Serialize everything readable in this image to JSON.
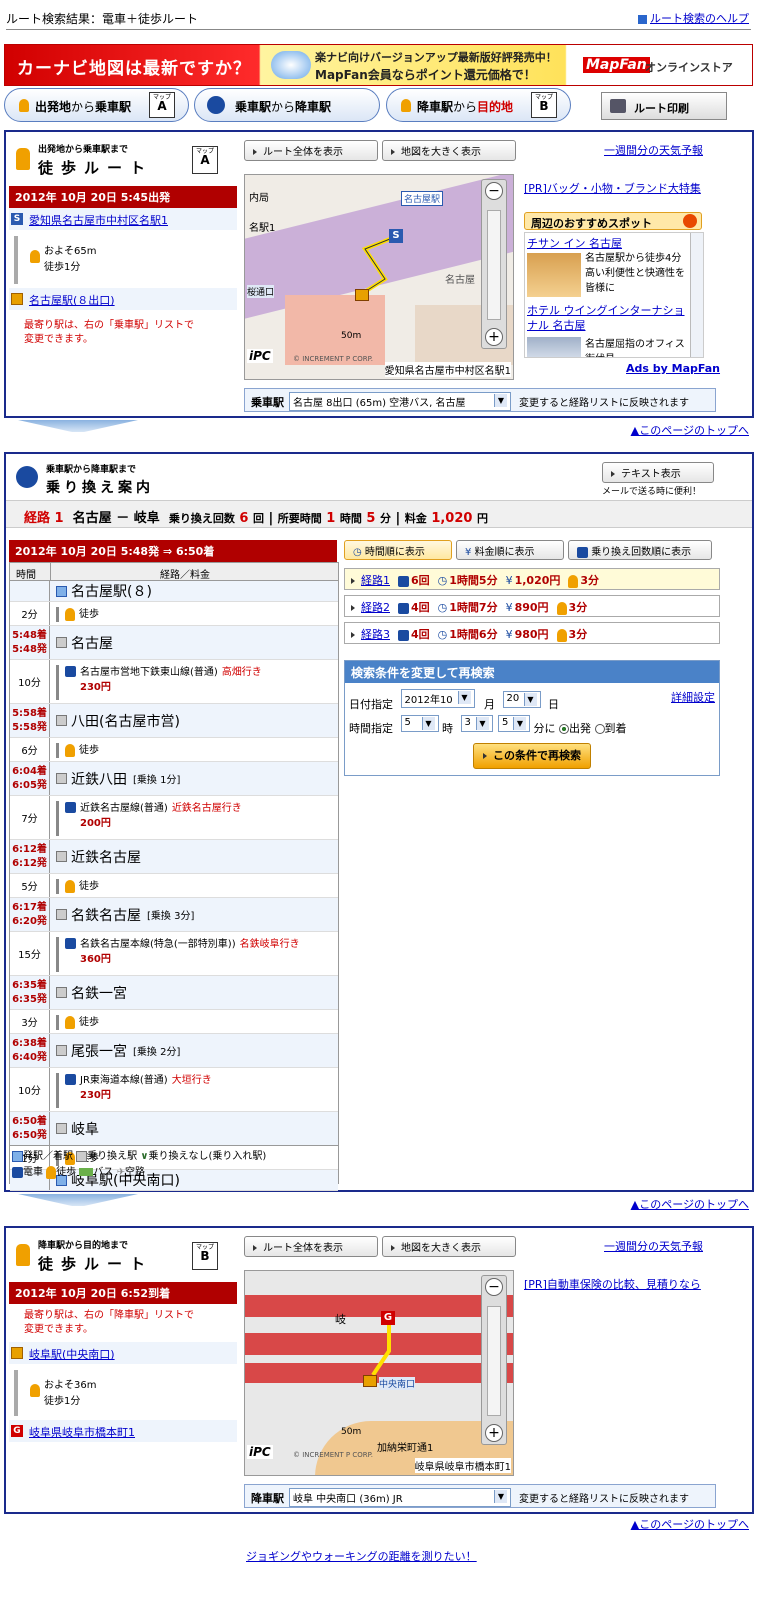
{
  "header": {
    "title": "ルート検索結果：電車＋徒歩ルート",
    "help_link": "ルート検索のヘルプ"
  },
  "banner": {
    "left_text": "カーナビ地図は最新ですか？",
    "middle_line1": "楽ナビ向けバージョンアップ最新版好評発売中！",
    "middle_line2": "MapFan会員ならポイント還元価格で！",
    "brand": "MapFan",
    "brand_sub": "オンラインストア"
  },
  "tabs": [
    {
      "label_pre": "出発地",
      "label_mid": "から",
      "label_post": "乗車駅",
      "map_badge": "A"
    },
    {
      "label_pre": "乗車駅",
      "label_mid": "から",
      "label_post": "降車駅",
      "map_badge": ""
    },
    {
      "label_pre": "降車駅",
      "label_mid": "から",
      "label_post": "目的地",
      "map_badge": "B"
    }
  ],
  "print_button": "ルート印刷",
  "map_badge_label": "マップ",
  "common": {
    "show_route": "ルート全体を表示",
    "enlarge_map": "地図を大きく表示",
    "weather": "一週間分の天気予報",
    "change_note": "変更すると経路リストに反映されます",
    "page_top": "▲このページのトップへ",
    "scale": "50m",
    "copyright": "© INCREMENT P CORP.",
    "ipc": "iPC",
    "walk_label": "徒歩"
  },
  "walk_a": {
    "small_title": "出発地から乗車駅まで",
    "big_title": "徒歩ルート",
    "badge": "A",
    "datetime": "2012年 10月 20日 5:45出発",
    "start_marker": "S",
    "start_place": "愛知県名古屋市中村区名駅1",
    "distance": "およそ65m",
    "time": "徒歩1分",
    "end_place": "名古屋駅(８出口)",
    "note_line1": "最寄り駅は、右の「乗車駅」リストで",
    "note_line2": "変更できます。",
    "map_address": "愛知県名古屋市中村区名駅1",
    "map_label_station": "名古屋駅",
    "map_label_1": "名駅1",
    "map_label_2": "名古屋",
    "map_label_3": "内局",
    "map_label_4": "桜通口",
    "pr": "[PR]バッグ・小物・ブランド大特集",
    "spots_title": "周辺のおすすめスポット",
    "spots": [
      {
        "name": "チサン イン 名古屋",
        "desc": "名古屋駅から徒歩4分 高い利便性と快適性を皆様に"
      },
      {
        "name": "ホテル ウイングインターナショナル 名古屋",
        "desc": "名古屋屈指のオフィス街伏見"
      }
    ],
    "ads": "Ads by MapFan",
    "station_select_label": "乗車駅",
    "station_select_value": "名古屋 8出口 (65m) 空港バス, 名古屋"
  },
  "transfer": {
    "small_title": "乗車駅から降車駅まで",
    "big_title": "乗り換え案内",
    "text_button": "テキスト表示",
    "mail_note": "メールで送る時に便利！",
    "summary_label": "経路",
    "summary_num": "1",
    "summary_from": "名古屋",
    "summary_dash": "－",
    "summary_to": "岐阜",
    "summary_transfers_label": "乗り換え回数",
    "summary_transfers": "6",
    "summary_transfers_unit": "回",
    "summary_time_label": "所要時間",
    "summary_hours": "1",
    "summary_hours_unit": "時間",
    "summary_mins": "5",
    "summary_mins_unit": "分",
    "summary_fare_label": "料金",
    "summary_fare": "1,020",
    "summary_fare_unit": "円",
    "datetime": "2012年 10月 20日 5:48発 ⇒ 6:50着",
    "sort_buttons": [
      "時間順に表示",
      "料金順に表示",
      "乗り換え回数順に表示"
    ],
    "col_time": "時間",
    "col_route": "経路／料金",
    "rows": [
      {
        "type": "station",
        "arr": "",
        "dep": "",
        "name": "名古屋駅(８)",
        "note": "",
        "end": true
      },
      {
        "type": "walk",
        "dur": "2分",
        "line": "徒歩",
        "dest": "",
        "fare": ""
      },
      {
        "type": "station",
        "arr": "5:48着",
        "dep": "5:48発",
        "name": "名古屋",
        "note": ""
      },
      {
        "type": "ride",
        "dur": "10分",
        "line": "名古屋市営地下鉄東山線(普通)",
        "dest": "高畑行き",
        "fare": "230円"
      },
      {
        "type": "station",
        "arr": "5:58着",
        "dep": "5:58発",
        "name": "八田(名古屋市営)",
        "note": ""
      },
      {
        "type": "walk",
        "dur": "6分",
        "line": "徒歩",
        "dest": "",
        "fare": ""
      },
      {
        "type": "station",
        "arr": "6:04着",
        "dep": "6:05発",
        "name": "近鉄八田",
        "note": "[乗換 1分]"
      },
      {
        "type": "ride",
        "dur": "7分",
        "line": "近鉄名古屋線(普通)",
        "dest": "近鉄名古屋行き",
        "fare": "200円"
      },
      {
        "type": "station",
        "arr": "6:12着",
        "dep": "6:12発",
        "name": "近鉄名古屋",
        "note": ""
      },
      {
        "type": "walk",
        "dur": "5分",
        "line": "徒歩",
        "dest": "",
        "fare": ""
      },
      {
        "type": "station",
        "arr": "6:17着",
        "dep": "6:20発",
        "name": "名鉄名古屋",
        "note": "[乗換 3分]"
      },
      {
        "type": "ride",
        "dur": "15分",
        "line": "名鉄名古屋本線(特急(一部特別車))",
        "dest": "名鉄岐阜行き",
        "fare": "360円"
      },
      {
        "type": "station",
        "arr": "6:35着",
        "dep": "6:35発",
        "name": "名鉄一宮",
        "note": ""
      },
      {
        "type": "walk",
        "dur": "3分",
        "line": "徒歩",
        "dest": "",
        "fare": ""
      },
      {
        "type": "station",
        "arr": "6:38着",
        "dep": "6:40発",
        "name": "尾張一宮",
        "note": "[乗換 2分]"
      },
      {
        "type": "ride",
        "dur": "10分",
        "line": "JR東海道本線(普通)",
        "dest": "大垣行き",
        "fare": "230円"
      },
      {
        "type": "station",
        "arr": "6:50着",
        "dep": "6:50発",
        "name": "岐阜",
        "note": ""
      },
      {
        "type": "walk",
        "dur": "1分",
        "line": "徒歩",
        "dest": "",
        "fare": ""
      },
      {
        "type": "station",
        "arr": "",
        "dep": "",
        "name": "岐阜駅(中央南口)",
        "note": "",
        "end": true
      }
    ],
    "legend_line1": [
      "発駅／着駅",
      "乗り換え駅",
      "乗り換えなし(乗り入れ駅)"
    ],
    "legend_line2": [
      "電車",
      "徒歩",
      "バス",
      "空路"
    ],
    "routes": [
      {
        "label": "経路1",
        "transfers": "6回",
        "time": "1時間5分",
        "fare": "1,020円",
        "walk": "3分",
        "highlight": true
      },
      {
        "label": "経路2",
        "transfers": "4回",
        "time": "1時間7分",
        "fare": "890円",
        "walk": "3分",
        "highlight": false
      },
      {
        "label": "経路3",
        "transfers": "4回",
        "time": "1時間6分",
        "fare": "980円",
        "walk": "3分",
        "highlight": false
      }
    ],
    "research": {
      "title": "検索条件を変更して再検索",
      "date_label": "日付指定",
      "year_month": "2012年10",
      "month_unit": "月",
      "day": "20",
      "day_unit": "日",
      "detail": "詳細設定",
      "time_label": "時間指定",
      "hour": "5",
      "hour_unit": "時",
      "min_tens": "3",
      "min_ones": "5",
      "min_unit": "分に",
      "depart": "出発",
      "arrive": "到着",
      "submit": "この条件で再検索"
    }
  },
  "walk_b": {
    "small_title": "降車駅から目的地まで",
    "big_title": "徒歩ルート",
    "badge": "B",
    "datetime": "2012年 10月 20日 6:52到着",
    "note_line1": "最寄り駅は、右の「降車駅」リストで",
    "note_line2": "変更できます。",
    "start_place": "岐阜駅(中央南口)",
    "distance": "およそ36m",
    "time": "徒歩1分",
    "goal_marker": "G",
    "end_place": "岐阜県岐阜市橋本町1",
    "map_address": "岐阜県岐阜市橋本町1",
    "map_label_1": "加納栄町通1",
    "map_label_2": "岐",
    "map_label_3": "中央南口",
    "pr": "[PR]自動車保険の比較、見積りなら",
    "station_select_label": "降車駅",
    "station_select_value": "岐阜 中央南口 (36m) JR"
  },
  "footer": {
    "link": "ジョギングやウォーキングの距離を測りたい！"
  }
}
